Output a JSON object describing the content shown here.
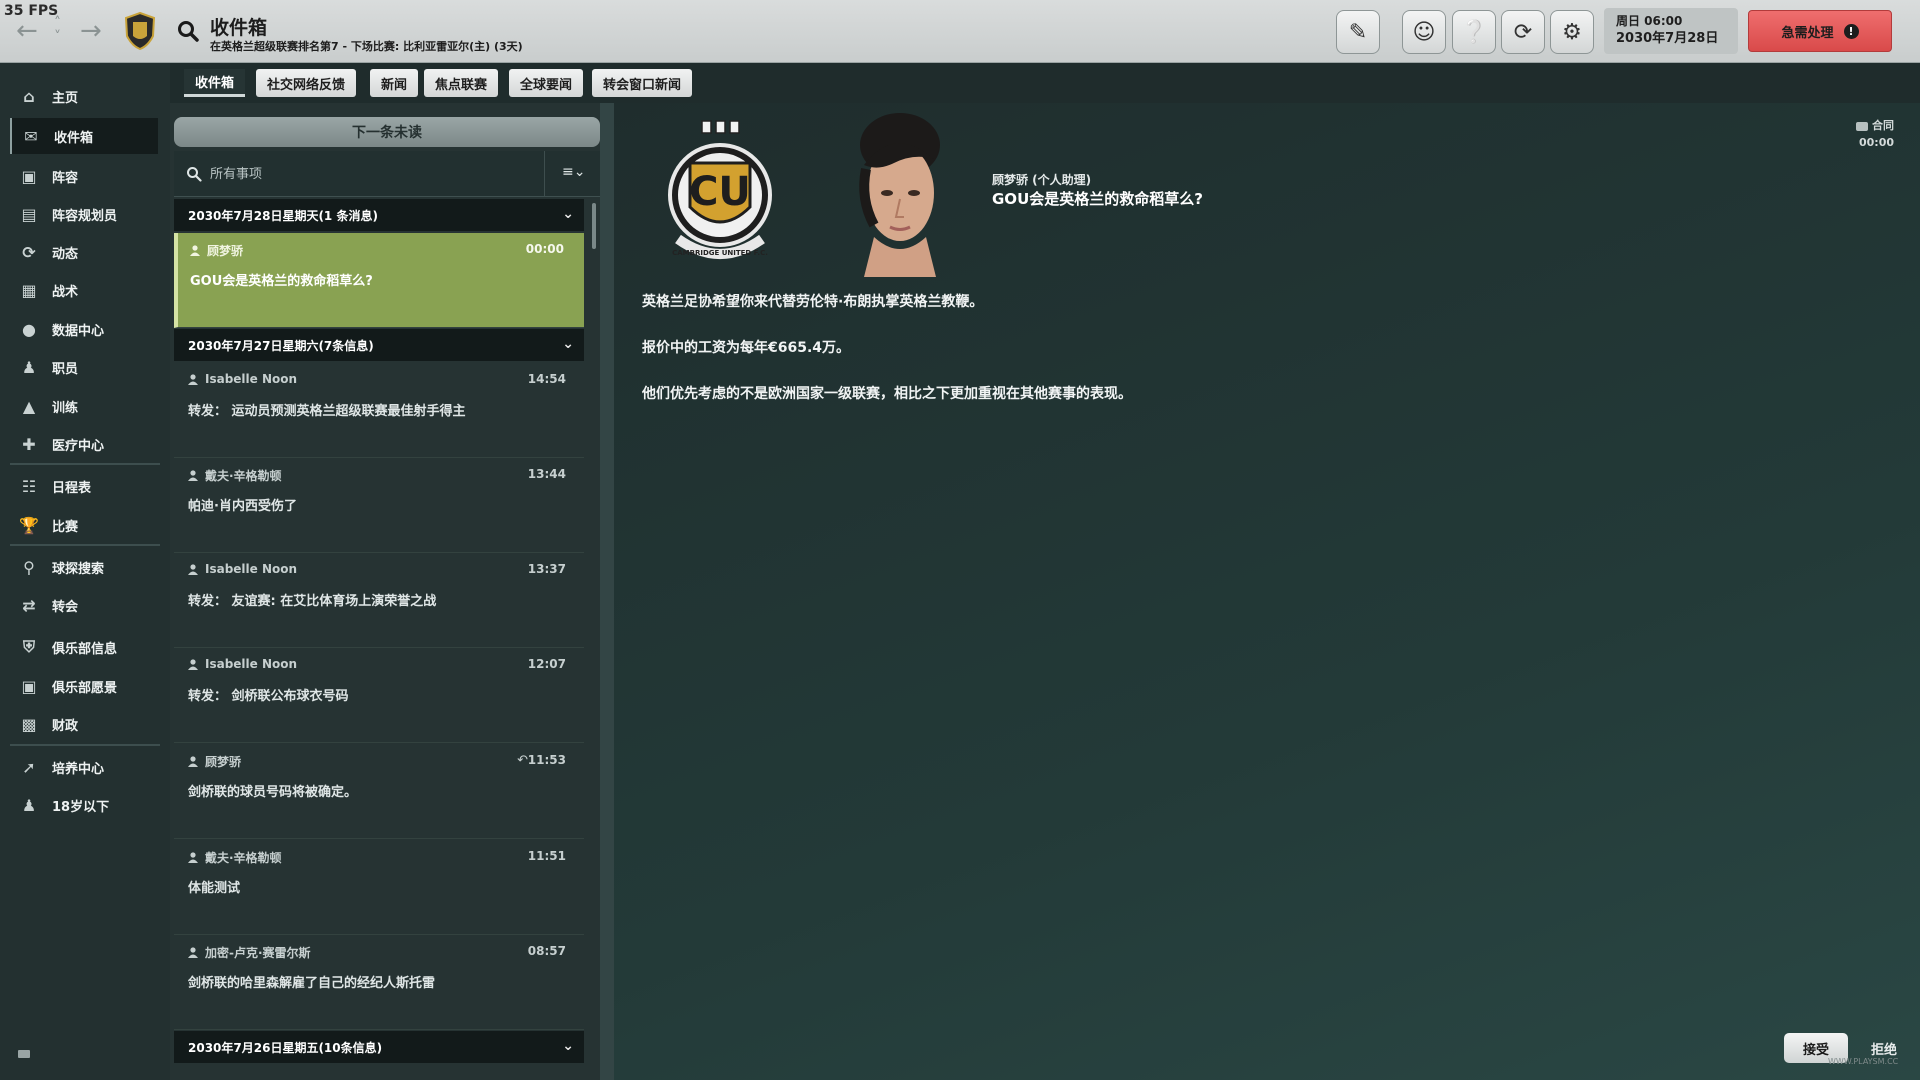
{
  "fps": "35 FPS",
  "header": {
    "title": "收件箱",
    "subtitle": "在英格兰超级联赛排名第7 - 下场比赛: 比利亚雷亚尔(主) (3天)",
    "date_line1": "周日 06:00",
    "date_line2": "2030年7月28日",
    "urgent_label": "急需处理",
    "urgent_icon": "!"
  },
  "sidebar": {
    "items": [
      {
        "label": "主页",
        "icon": "home-icon"
      },
      {
        "label": "收件箱",
        "icon": "inbox-icon"
      },
      {
        "label": "阵容",
        "icon": "shirt-icon"
      },
      {
        "label": "阵容规划员",
        "icon": "clipboard-icon"
      },
      {
        "label": "动态",
        "icon": "dynamics-icon"
      },
      {
        "label": "战术",
        "icon": "tactics-icon"
      },
      {
        "label": "数据中心",
        "icon": "data-icon"
      },
      {
        "label": "职员",
        "icon": "staff-icon"
      },
      {
        "label": "训练",
        "icon": "training-icon"
      },
      {
        "label": "医疗中心",
        "icon": "medical-icon"
      },
      {
        "label": "日程表",
        "icon": "calendar-icon"
      },
      {
        "label": "比赛",
        "icon": "trophy-icon"
      },
      {
        "label": "球探搜索",
        "icon": "scout-search-icon"
      },
      {
        "label": "转会",
        "icon": "transfer-icon"
      },
      {
        "label": "俱乐部信息",
        "icon": "shield-icon"
      },
      {
        "label": "俱乐部愿景",
        "icon": "briefcase-icon"
      },
      {
        "label": "财政",
        "icon": "finance-icon"
      },
      {
        "label": "培养中心",
        "icon": "development-icon"
      },
      {
        "label": "18岁以下",
        "icon": "youth-icon"
      }
    ]
  },
  "tabs": [
    "收件箱",
    "社交网络反馈",
    "新闻",
    "焦点联赛",
    "全球要闻",
    "转会窗口新闻"
  ],
  "inbox": {
    "next_unread": "下一条未读",
    "search_placeholder": "所有事项",
    "filter_menu": "≡⌄",
    "groups": [
      {
        "title": "2030年7月28日星期天(1 条消息)"
      },
      {
        "title": "2030年7月27日星期六(7条信息)"
      },
      {
        "title": "2030年7月26日星期五(10条信息)"
      }
    ],
    "messages": [
      {
        "sender": "顾梦骄",
        "time": "00:00",
        "subject": "GOU会是英格兰的救命稻草么?"
      },
      {
        "sender": "Isabelle Noon",
        "time": "14:54",
        "subject": "转发： 运动员预测英格兰超级联赛最佳射手得主"
      },
      {
        "sender": "戴夫·辛格勒顿",
        "time": "13:44",
        "subject": "帕迪·肖内西受伤了"
      },
      {
        "sender": "Isabelle Noon",
        "time": "13:37",
        "subject": "转发： 友谊赛: 在艾比体育场上演荣誉之战"
      },
      {
        "sender": "Isabelle Noon",
        "time": "12:07",
        "subject": "转发： 剑桥联公布球衣号码"
      },
      {
        "sender": "顾梦骄",
        "time": "11:53",
        "subject": "剑桥联的球员号码将被确定。"
      },
      {
        "sender": "戴夫·辛格勒顿",
        "time": "11:51",
        "subject": "体能测试"
      },
      {
        "sender": "加密-卢克·赛雷尔斯",
        "time": "08:57",
        "subject": "剑桥联的哈里森解雇了自己的经纪人斯托雷"
      }
    ]
  },
  "detail": {
    "sender_role": "顾梦骄 (个人助理)",
    "title": "GOU会是英格兰的救命稻草么?",
    "contract_label": "合同",
    "contract_time": "00:00",
    "paragraphs": [
      "英格兰足协希望你来代替劳伦特·布朗执掌英格兰教鞭。",
      "报价中的工资为每年€665.4万。",
      "他们优先考虑的不是欧洲国家一级联赛，相比之下更加重视在其他赛事的表现。"
    ],
    "accept_label": "接受",
    "reject_label": "拒绝",
    "crest_text": "CU",
    "crest_ring_text": "CAMBRIDGE UNITED F.C.",
    "watermark": "WWW.PLAYSM.CC"
  },
  "colors": {
    "urgent": "#e05555",
    "selected_message": "#89a252",
    "sidebar_bg": "#233030"
  }
}
